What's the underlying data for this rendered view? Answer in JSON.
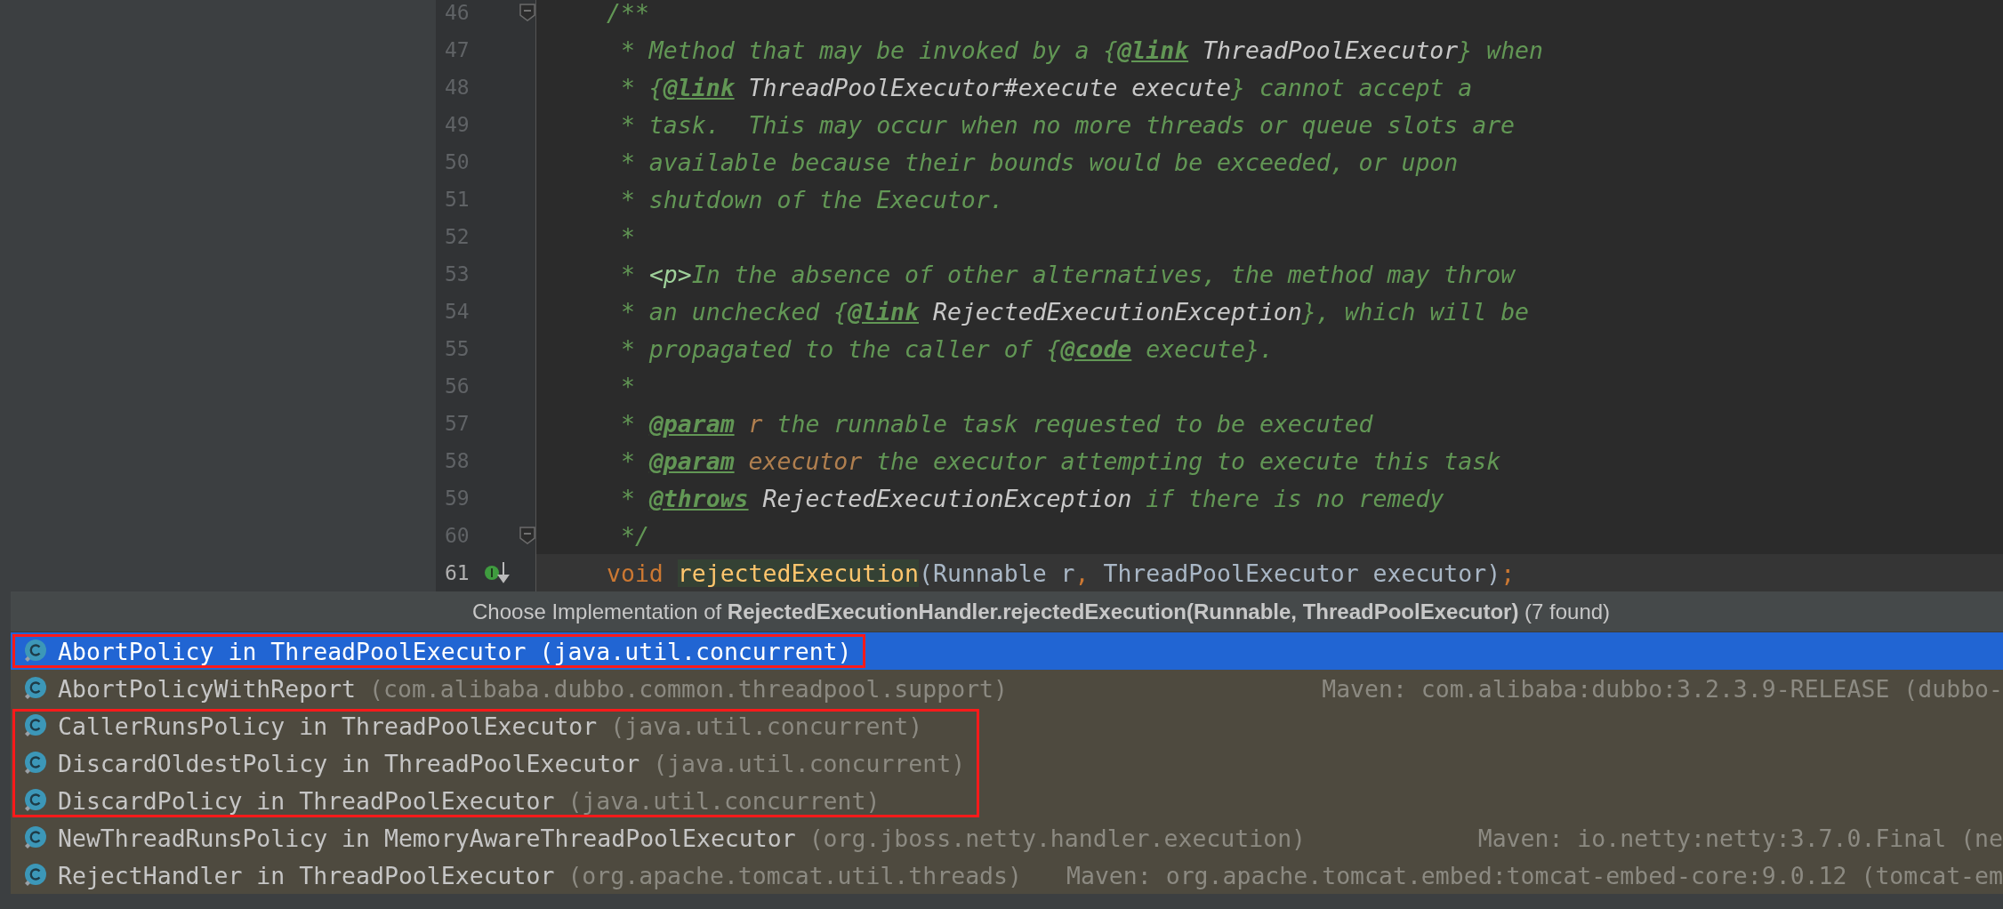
{
  "editor": {
    "lines": [
      {
        "number": "46",
        "fold_marker": true,
        "current": false,
        "gutter_icon": false,
        "tokens": [
          {
            "kind": "comment",
            "text": "/**"
          }
        ]
      },
      {
        "number": "47",
        "fold_marker": false,
        "current": false,
        "gutter_icon": false,
        "tokens": [
          {
            "kind": "comment",
            "text": " * Method that may be invoked by a {"
          },
          {
            "kind": "tag",
            "text": "@link"
          },
          {
            "kind": "ref",
            "text": " ThreadPoolExecutor"
          },
          {
            "kind": "comment",
            "text": "} when"
          }
        ]
      },
      {
        "number": "48",
        "fold_marker": false,
        "current": false,
        "gutter_icon": false,
        "tokens": [
          {
            "kind": "comment",
            "text": " * {"
          },
          {
            "kind": "tag",
            "text": "@link"
          },
          {
            "kind": "ref",
            "text": " ThreadPoolExecutor#execute execute"
          },
          {
            "kind": "comment",
            "text": "} cannot accept a"
          }
        ]
      },
      {
        "number": "49",
        "fold_marker": false,
        "current": false,
        "gutter_icon": false,
        "tokens": [
          {
            "kind": "comment",
            "text": " * task.  This may occur when no more threads or queue slots are"
          }
        ]
      },
      {
        "number": "50",
        "fold_marker": false,
        "current": false,
        "gutter_icon": false,
        "tokens": [
          {
            "kind": "comment",
            "text": " * available because their bounds would be exceeded, or upon"
          }
        ]
      },
      {
        "number": "51",
        "fold_marker": false,
        "current": false,
        "gutter_icon": false,
        "tokens": [
          {
            "kind": "comment",
            "text": " * shutdown of the Executor."
          }
        ]
      },
      {
        "number": "52",
        "fold_marker": false,
        "current": false,
        "gutter_icon": false,
        "tokens": [
          {
            "kind": "comment",
            "text": " *"
          }
        ]
      },
      {
        "number": "53",
        "fold_marker": false,
        "current": false,
        "gutter_icon": false,
        "tokens": [
          {
            "kind": "comment",
            "text": " * "
          },
          {
            "kind": "markup",
            "text": "<p>"
          },
          {
            "kind": "comment",
            "text": "In the absence of other alternatives, the method may throw"
          }
        ]
      },
      {
        "number": "54",
        "fold_marker": false,
        "current": false,
        "gutter_icon": false,
        "tokens": [
          {
            "kind": "comment",
            "text": " * an unchecked {"
          },
          {
            "kind": "tag",
            "text": "@link"
          },
          {
            "kind": "ref",
            "text": " RejectedExecutionException"
          },
          {
            "kind": "comment",
            "text": "}, which will be"
          }
        ]
      },
      {
        "number": "55",
        "fold_marker": false,
        "current": false,
        "gutter_icon": false,
        "tokens": [
          {
            "kind": "comment",
            "text": " * propagated to the caller of {"
          },
          {
            "kind": "tag",
            "text": "@code"
          },
          {
            "kind": "comment",
            "text": " execute}."
          }
        ]
      },
      {
        "number": "56",
        "fold_marker": false,
        "current": false,
        "gutter_icon": false,
        "tokens": [
          {
            "kind": "comment",
            "text": " *"
          }
        ]
      },
      {
        "number": "57",
        "fold_marker": false,
        "current": false,
        "gutter_icon": false,
        "tokens": [
          {
            "kind": "comment",
            "text": " * "
          },
          {
            "kind": "tag",
            "text": "@param"
          },
          {
            "kind": "param",
            "text": " r"
          },
          {
            "kind": "comment",
            "text": " the runnable task requested to be executed"
          }
        ]
      },
      {
        "number": "58",
        "fold_marker": false,
        "current": false,
        "gutter_icon": false,
        "tokens": [
          {
            "kind": "comment",
            "text": " * "
          },
          {
            "kind": "tag",
            "text": "@param"
          },
          {
            "kind": "param",
            "text": " executor"
          },
          {
            "kind": "comment",
            "text": " the executor attempting to execute this task"
          }
        ]
      },
      {
        "number": "59",
        "fold_marker": false,
        "current": false,
        "gutter_icon": false,
        "tokens": [
          {
            "kind": "comment",
            "text": " * "
          },
          {
            "kind": "tag",
            "text": "@throws"
          },
          {
            "kind": "ref",
            "text": " RejectedExecutionException"
          },
          {
            "kind": "comment",
            "text": " if there is no remedy"
          }
        ]
      },
      {
        "number": "60",
        "fold_marker": true,
        "current": false,
        "gutter_icon": false,
        "tokens": [
          {
            "kind": "comment",
            "text": " */"
          }
        ]
      },
      {
        "number": "61",
        "fold_marker": false,
        "current": true,
        "gutter_icon": true,
        "tokens": [
          {
            "kind": "keyword",
            "text": "void "
          },
          {
            "kind": "method",
            "text": "rejectedExecution"
          },
          {
            "kind": "plain",
            "text": "(Runnable r"
          },
          {
            "kind": "keyword",
            "text": ","
          },
          {
            "kind": "plain",
            "text": " ThreadPoolExecutor executor)"
          },
          {
            "kind": "keyword",
            "text": ";"
          }
        ]
      }
    ]
  },
  "popup": {
    "title": "Choose Implementation of **RejectedExecutionHandler.rejectedExecution(Runnable, ThreadPoolExecutor)** (7 found)",
    "groups": [
      {
        "outlined": true,
        "items": [
          {
            "name": "AbortPolicy in ThreadPoolExecutor",
            "package": "(java.util.concurrent)",
            "selected": true
          }
        ]
      },
      {
        "outlined": false,
        "items": [
          {
            "name": "AbortPolicyWithReport",
            "package": "(com.alibaba.dubbo.common.threadpool.support)",
            "location": "Maven: com.alibaba:dubbo:3.2.3.9-RELEASE (dubbo-",
            "selected": false
          }
        ]
      },
      {
        "outlined": true,
        "items": [
          {
            "name": "CallerRunsPolicy in ThreadPoolExecutor",
            "package": "(java.util.concurrent)",
            "selected": false
          },
          {
            "name": "DiscardOldestPolicy in ThreadPoolExecutor",
            "package": "(java.util.concurrent)",
            "selected": false
          },
          {
            "name": "DiscardPolicy in ThreadPoolExecutor",
            "package": "(java.util.concurrent)",
            "selected": false
          }
        ]
      },
      {
        "outlined": false,
        "items": [
          {
            "name": "NewThreadRunsPolicy in MemoryAwareThreadPoolExecutor",
            "package": "(org.jboss.netty.handler.execution)",
            "location": "Maven: io.netty:netty:3.7.0.Final (ne",
            "selected": false
          },
          {
            "name": "RejectHandler in ThreadPoolExecutor",
            "package": "(org.apache.tomcat.util.threads)",
            "location": "Maven: org.apache.tomcat.embed:tomcat-embed-core:9.0.12 (tomcat-em",
            "selected": false
          }
        ]
      }
    ]
  }
}
